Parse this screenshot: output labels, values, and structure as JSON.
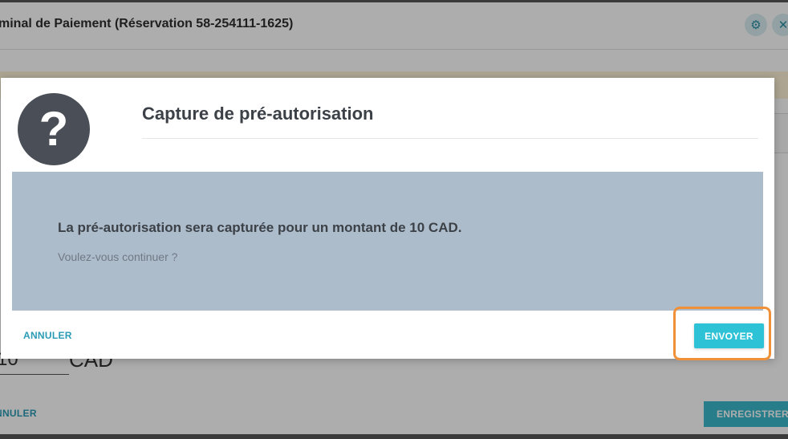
{
  "background": {
    "window_title": "minal de Paiement (Réservation 58-254111-1625)",
    "settings_icon": "gear-icon",
    "close_icon": "close-icon",
    "amount_value": "10",
    "currency": "CAD",
    "cancel_label": "NNULER",
    "save_label": "ENREGISTRER"
  },
  "dialog": {
    "icon": "question-icon",
    "icon_glyph": "?",
    "title": "Capture de pré-autorisation",
    "message": "La pré-autorisation sera capturée pour un montant de 10 CAD.",
    "question": "Voulez-vous continuer ?",
    "cancel_label": "ANNULER",
    "send_label": "ENVOYER"
  },
  "colors": {
    "accent": "#2ec2d6",
    "link": "#2a9bb5",
    "message_bg": "#adbccb",
    "highlight": "#f0913a",
    "icon_bg": "#4a4f57"
  }
}
